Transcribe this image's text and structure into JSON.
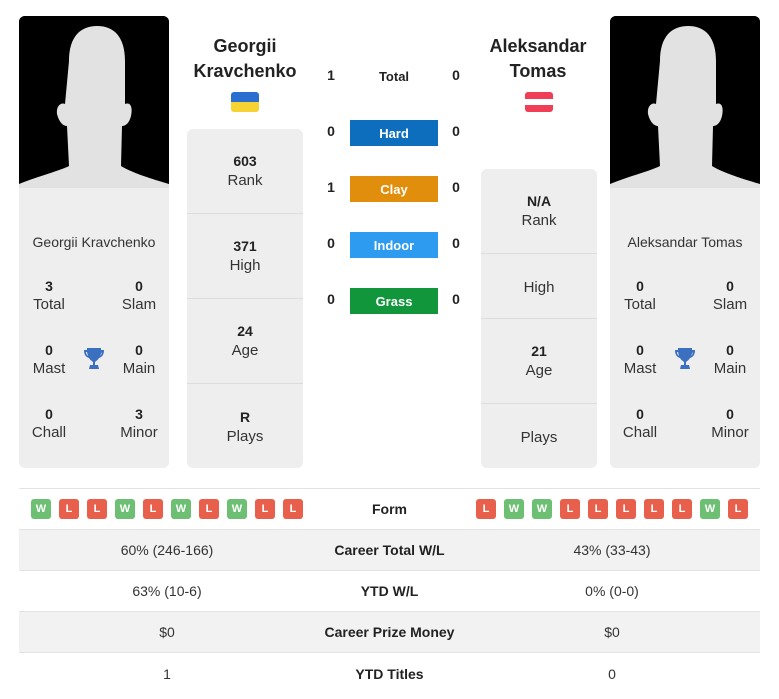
{
  "player1": {
    "name_line1": "Georgii",
    "name_line2": "Kravchenko",
    "card_name": "Georgii Kravchenko",
    "flag": "ukraine-flag",
    "flag_colors": [
      "#2a6fd0",
      "#f7d233"
    ],
    "titles": {
      "total": {
        "value": "3",
        "label": "Total"
      },
      "slam": {
        "value": "0",
        "label": "Slam"
      },
      "mast": {
        "value": "0",
        "label": "Mast"
      },
      "main": {
        "value": "0",
        "label": "Main"
      },
      "chall": {
        "value": "0",
        "label": "Chall"
      },
      "minor": {
        "value": "3",
        "label": "Minor"
      }
    },
    "info": [
      {
        "value": "603",
        "label": "Rank"
      },
      {
        "value": "371",
        "label": "High"
      },
      {
        "value": "24",
        "label": "Age"
      },
      {
        "value": "R",
        "label": "Plays"
      }
    ],
    "form": [
      "W",
      "L",
      "L",
      "W",
      "L",
      "W",
      "L",
      "W",
      "L",
      "L"
    ]
  },
  "player2": {
    "name_line1": "Aleksandar",
    "name_line2": "Tomas",
    "card_name": "Aleksandar Tomas",
    "flag": "austria-flag",
    "flag_colors": [
      "#ef3e55",
      "#ffffff"
    ],
    "titles": {
      "total": {
        "value": "0",
        "label": "Total"
      },
      "slam": {
        "value": "0",
        "label": "Slam"
      },
      "mast": {
        "value": "0",
        "label": "Mast"
      },
      "main": {
        "value": "0",
        "label": "Main"
      },
      "chall": {
        "value": "0",
        "label": "Chall"
      },
      "minor": {
        "value": "0",
        "label": "Minor"
      }
    },
    "info": [
      {
        "value": "N/A",
        "label": "Rank"
      },
      {
        "value": "",
        "label": "High"
      },
      {
        "value": "21",
        "label": "Age"
      },
      {
        "value": "",
        "label": "Plays"
      }
    ],
    "form": [
      "L",
      "W",
      "W",
      "L",
      "L",
      "L",
      "L",
      "L",
      "W",
      "L"
    ]
  },
  "h2h": [
    {
      "label": "Total",
      "p1": "1",
      "p2": "0",
      "color": null
    },
    {
      "label": "Hard",
      "p1": "0",
      "p2": "0",
      "color": "#0d6ebd"
    },
    {
      "label": "Clay",
      "p1": "1",
      "p2": "0",
      "color": "#e08e0b"
    },
    {
      "label": "Indoor",
      "p1": "0",
      "p2": "0",
      "color": "#2d9bf0"
    },
    {
      "label": "Grass",
      "p1": "0",
      "p2": "0",
      "color": "#12963c"
    }
  ],
  "table": {
    "form_label": "Form",
    "rows": [
      {
        "label": "Career Total W/L",
        "p1": "60% (246-166)",
        "p2": "43% (33-43)"
      },
      {
        "label": "YTD W/L",
        "p1": "63% (10-6)",
        "p2": "0% (0-0)"
      },
      {
        "label": "Career Prize Money",
        "p1": "$0",
        "p2": "$0"
      },
      {
        "label": "YTD Titles",
        "p1": "1",
        "p2": "0"
      }
    ]
  }
}
